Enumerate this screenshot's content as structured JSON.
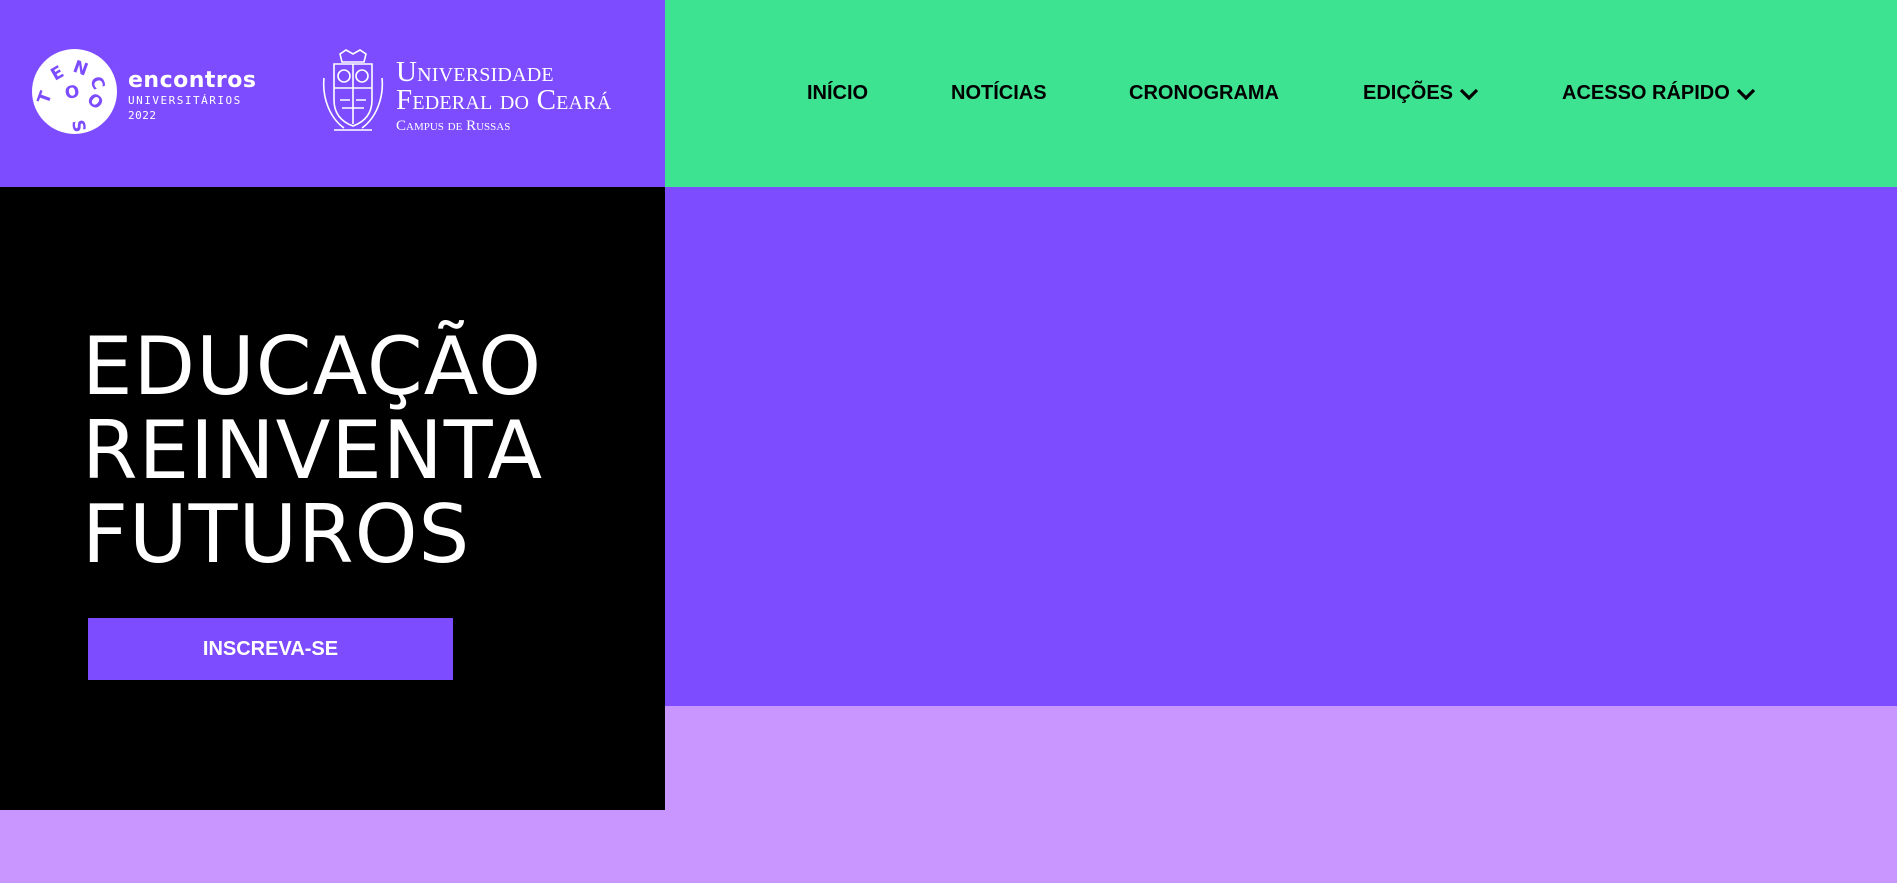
{
  "colors": {
    "purple": "#7D4CFF",
    "green": "#3DE390",
    "black": "#000000",
    "lilac": "#C995FE",
    "white": "#FFFFFF"
  },
  "brand": {
    "encontros": {
      "logo_letters": "ENCONTROS",
      "title": "encontros",
      "subtitle": "UNIVERSITÁRIOS",
      "year": "2022"
    },
    "ufc": {
      "line1": "Universidade",
      "line2": "Federal do Ceará",
      "line3": "Campus de Russas"
    }
  },
  "nav": {
    "items": [
      {
        "label": "INÍCIO",
        "icon": null
      },
      {
        "label": "NOTÍCIAS",
        "icon": null
      },
      {
        "label": "CRONOGRAMA",
        "icon": null
      },
      {
        "label": "EDIÇÕES",
        "icon": "chevron-down-icon"
      },
      {
        "label": "ACESSO RÁPIDO",
        "icon": "chevron-down-icon"
      }
    ]
  },
  "hero": {
    "title_lines": [
      "EDUCAÇÃO",
      "REINVENTA",
      "FUTUROS"
    ],
    "cta_label": "INSCREVA-SE"
  }
}
